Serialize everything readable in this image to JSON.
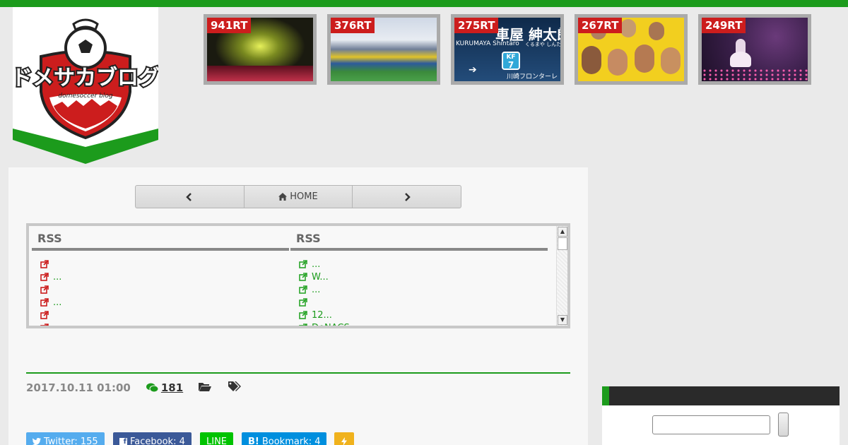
{
  "logo": {
    "title": "ドメサカブログ",
    "subtitle": "domesoccer blog"
  },
  "popular": [
    {
      "rt": "941RT",
      "scene": "concert-stage"
    },
    {
      "rt": "376RT",
      "scene": "stadium"
    },
    {
      "rt": "275RT",
      "scene": "player-card",
      "name_jp": "車屋 紳太郎",
      "name_en": "KURUMAYA Shintaro",
      "kana": "くるまや しんたろう",
      "position": "KF",
      "number": "7",
      "club": "川崎フロンターレ"
    },
    {
      "rt": "267RT",
      "scene": "team-photo"
    },
    {
      "rt": "249RT",
      "scene": "concert-performer"
    }
  ],
  "nav": {
    "prev_icon": "chevron-left-icon",
    "home_label": "HOME",
    "next_icon": "chevron-right-icon"
  },
  "rss": {
    "left": {
      "title": "RSS",
      "items": [
        "",
        "...",
        "",
        "...",
        "",
        ""
      ]
    },
    "right": {
      "title": "RSS",
      "items": [
        "...",
        "W...",
        "...",
        "",
        "12...",
        "DeNACS..."
      ]
    }
  },
  "post": {
    "date": "2017.10.11 01:00",
    "comments": "181"
  },
  "share": {
    "twitter": "Twitter: 155",
    "facebook": "Facebook: 4",
    "line": "LINE",
    "bookmark": "Bookmark: 4"
  },
  "colors": {
    "accent": "#1c9b1c",
    "brand_red": "#cc1d1d",
    "dark": "#2a2a2a"
  }
}
